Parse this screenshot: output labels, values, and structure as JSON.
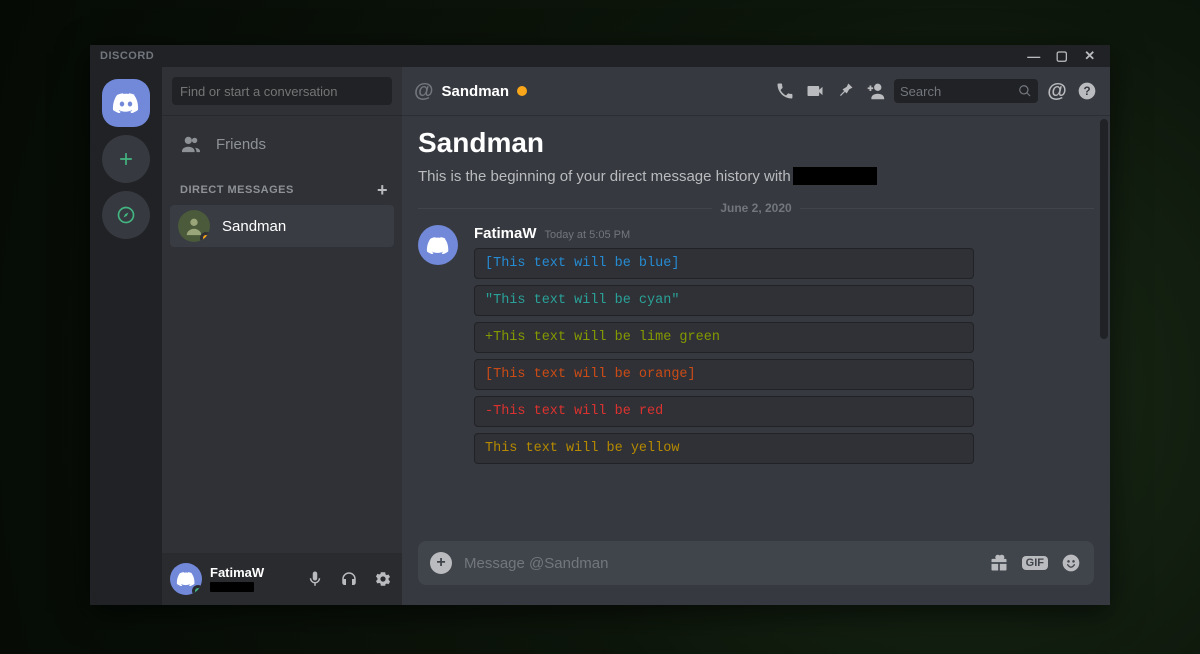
{
  "app": {
    "wordmark": "DISCORD"
  },
  "window_controls": {
    "min": "—",
    "max": "▢",
    "close": "✕"
  },
  "dm_sidebar": {
    "search_placeholder": "Find or start a conversation",
    "friends_label": "Friends",
    "section_label": "Direct Messages",
    "items": [
      {
        "name": "Sandman",
        "status": "idle",
        "active": true
      }
    ]
  },
  "user_panel": {
    "username": "FatimaW",
    "status": "online"
  },
  "chat": {
    "channel_name": "Sandman",
    "header_search_placeholder": "Search",
    "welcome_title": "Sandman",
    "welcome_text": "This is the beginning of your direct message history with",
    "divider_date": "June 2, 2020",
    "message": {
      "author": "FatimaW",
      "timestamp": "Today at 5:05 PM",
      "code_blocks": [
        {
          "text": "[This text will be blue]",
          "color": "blue"
        },
        {
          "text": "\"This text will be cyan\"",
          "color": "cyan"
        },
        {
          "text": "+This text will be lime green",
          "color": "green"
        },
        {
          "text": "[This text will be orange]",
          "color": "orange"
        },
        {
          "text": "-This text will be red",
          "color": "red"
        },
        {
          "text": "This text will be yellow",
          "color": "yellow"
        }
      ]
    },
    "composer_placeholder": "Message @Sandman",
    "gif_label": "GIF"
  }
}
